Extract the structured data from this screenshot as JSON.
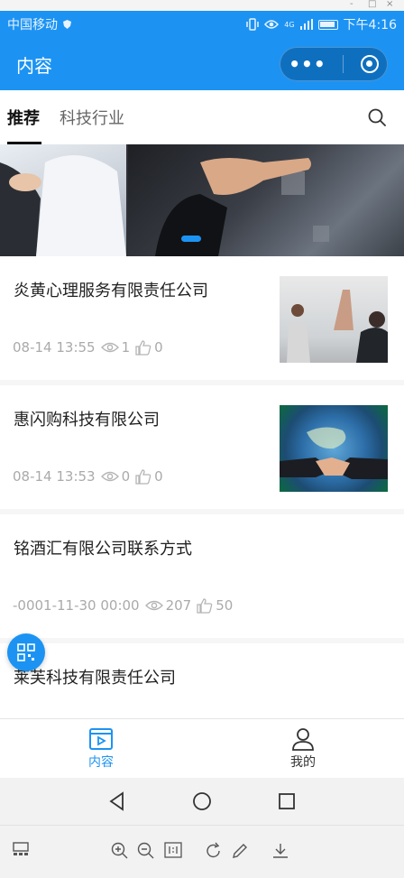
{
  "window_controls": [
    "-",
    "□",
    "×"
  ],
  "status_bar": {
    "carrier": "中国移动",
    "signal": "4G",
    "time": "下午4:16"
  },
  "navbar": {
    "title": "内容",
    "more_label": "•••"
  },
  "tabs": [
    {
      "label": "推荐",
      "active": true
    },
    {
      "label": "科技行业",
      "active": false
    }
  ],
  "list": [
    {
      "name": "炎黄心理服务有限责任公司",
      "date": "08-14 13:55",
      "views": "1",
      "likes": "0"
    },
    {
      "name": "惠闪购科技有限公司",
      "date": "08-14 13:53",
      "views": "0",
      "likes": "0"
    },
    {
      "name": "铭酒汇有限公司联系方式",
      "date": "-0001-11-30 00:00",
      "views": "207",
      "likes": "50"
    },
    {
      "name": "莱芙科技有限责任公司"
    }
  ],
  "tabbar": [
    {
      "label": "内容",
      "icon": "video-icon",
      "active": true
    },
    {
      "label": "我的",
      "icon": "person-icon",
      "active": false
    }
  ],
  "colors": {
    "accent": "#1c93f3",
    "text_primary": "#222222",
    "text_secondary": "#aaaaaa"
  }
}
